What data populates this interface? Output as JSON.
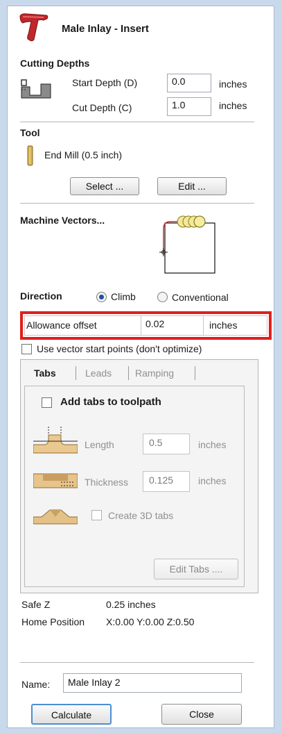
{
  "header": {
    "title": "Male Inlay - Insert"
  },
  "cutting_depths": {
    "heading": "Cutting Depths",
    "start_depth_label": "Start Depth (D)",
    "start_depth_value": "0.0",
    "start_depth_unit": "inches",
    "cut_depth_label": "Cut Depth (C)",
    "cut_depth_value": "1.0",
    "cut_depth_unit": "inches"
  },
  "tool": {
    "heading": "Tool",
    "name": "End Mill (0.5 inch)",
    "select_label": "Select ...",
    "edit_label": "Edit ..."
  },
  "machine_vectors": {
    "heading": "Machine Vectors..."
  },
  "direction": {
    "label": "Direction",
    "climb_label": "Climb",
    "conventional_label": "Conventional",
    "selected": "Climb"
  },
  "allowance": {
    "label": "Allowance offset",
    "value": "0.02",
    "unit": "inches"
  },
  "vector_start": {
    "label": "Use vector start points (don't optimize)",
    "checked": false
  },
  "tabs_panel": {
    "tabs": [
      "Tabs",
      "Leads",
      "Ramping"
    ],
    "active_tab": "Tabs",
    "add_tabs_label": "Add tabs to toolpath",
    "length_label": "Length",
    "length_value": "0.5",
    "length_unit": "inches",
    "thickness_label": "Thickness",
    "thickness_value": "0.125",
    "thickness_unit": "inches",
    "create_3d_label": "Create 3D tabs",
    "edit_tabs_label": "Edit Tabs ...."
  },
  "info": {
    "safe_z_label": "Safe Z",
    "safe_z_value": "0.25 inches",
    "home_label": "Home Position",
    "home_value": "X:0.00 Y:0.00 Z:0.50"
  },
  "name_field": {
    "label": "Name:",
    "value": "Male Inlay 2"
  },
  "footer": {
    "calculate_label": "Calculate",
    "close_label": "Close"
  },
  "colors": {
    "logo_red": "#c0262b",
    "highlight_red": "#e0201c",
    "radio_blue": "#1f4fa7"
  }
}
